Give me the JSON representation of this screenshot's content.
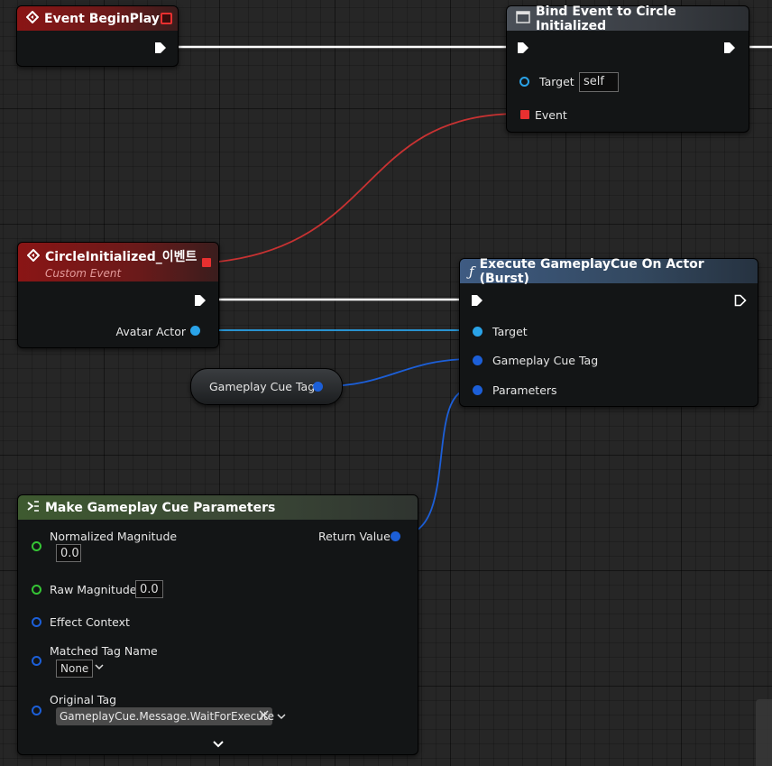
{
  "nodes": {
    "begin_play": {
      "title": "Event BeginPlay"
    },
    "bind_event": {
      "title": "Bind Event to Circle Initialized",
      "target_label": "Target",
      "target_value": "self",
      "event_label": "Event"
    },
    "custom_event": {
      "title": "CircleInitialized_이벤트",
      "subtitle": "Custom Event",
      "avatar_label": "Avatar Actor"
    },
    "execute_cue": {
      "title": "Execute GameplayCue On Actor (Burst)",
      "func_glyph": "ƒ",
      "target_label": "Target",
      "tag_label": "Gameplay Cue Tag",
      "params_label": "Parameters"
    },
    "cue_tag_var": {
      "title": "Gameplay Cue Tag"
    },
    "make_params": {
      "title": "Make Gameplay Cue Parameters",
      "normalized_label": "Normalized Magnitude",
      "normalized_value": "0.0",
      "raw_label": "Raw Magnitude",
      "raw_value": "0.0",
      "effect_label": "Effect Context",
      "matched_label": "Matched Tag Name",
      "matched_value": "None",
      "original_label": "Original Tag",
      "original_value": "GameplayCue.Message.WaitForExecute",
      "return_label": "Return Value"
    }
  },
  "colors": {
    "exec_wire": "#ffffff",
    "delegate_wire": "#c83232",
    "object_wire": "#2aa3e8",
    "struct_wire": "#1c5fd8"
  }
}
